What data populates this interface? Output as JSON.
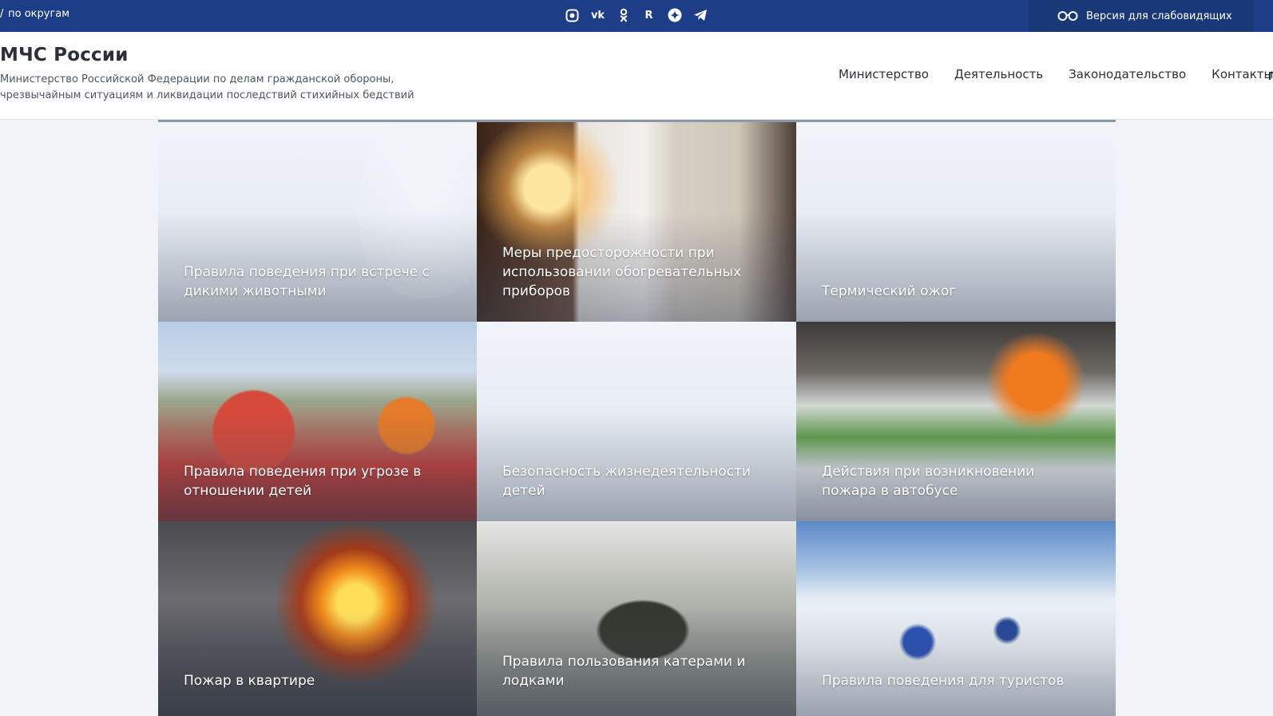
{
  "topbar": {
    "regions_label": "по округам",
    "socials": [
      {
        "name": "rutube-icon",
        "glyph": "◙"
      },
      {
        "name": "vk-icon",
        "glyph": "vk"
      },
      {
        "name": "odnoklassniki-icon",
        "glyph": "ок"
      },
      {
        "name": "rutube-r-icon",
        "glyph": "R"
      },
      {
        "name": "dzen-icon",
        "glyph": "✚"
      },
      {
        "name": "telegram-icon",
        "glyph": "➤"
      }
    ],
    "vision_label": "Версия для слабовидящих"
  },
  "header": {
    "title": "МЧС России",
    "subtitle_line1": "Министерство Российской Федерации по делам гражданской обороны,",
    "subtitle_line2": "чрезвычайным ситуациям и ликвидации последствий стихийных бедствий",
    "nav": [
      "Министерство",
      "Деятельность",
      "Законодательство",
      "Контакты"
    ]
  },
  "tiles": [
    {
      "caption": "Правила поведения при встрече с дикими животными"
    },
    {
      "caption": "Меры предосторожности при использовании обогревательных приборов"
    },
    {
      "caption": "Термический ожог"
    },
    {
      "caption": "Правила поведения при угрозе в отношении детей"
    },
    {
      "caption": "Безопасность жизнедеятельности детей"
    },
    {
      "caption": "Действия при возникновении пожара в автобусе"
    },
    {
      "caption": "Пожар в квартире"
    },
    {
      "caption": "Правила пользования катерами и лодками"
    },
    {
      "caption": "Правила поведения для туристов"
    }
  ],
  "colors": {
    "topbar": "#1d3e86",
    "vision_bg": "#193878",
    "page_bg": "#f0f3f8"
  }
}
